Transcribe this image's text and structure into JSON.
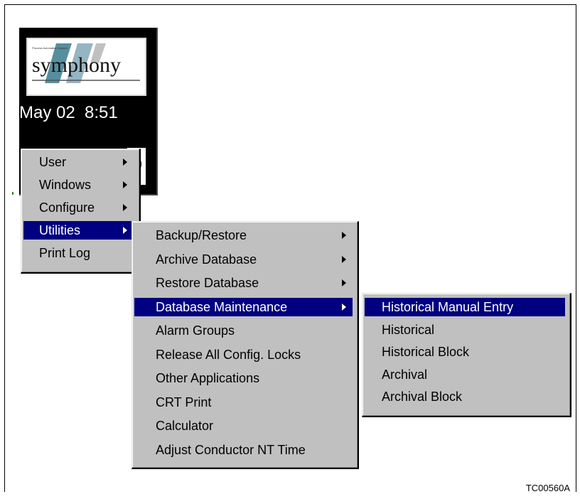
{
  "panel": {
    "logo_text": "symphony",
    "logo_tag": "Process Automation System",
    "clock": "May 02  8:51"
  },
  "main_menu": {
    "items": [
      {
        "label": "User",
        "has_submenu": true
      },
      {
        "label": "Windows",
        "has_submenu": true
      },
      {
        "label": "Configure",
        "has_submenu": true
      },
      {
        "label": "Utilities",
        "has_submenu": true,
        "selected": true
      },
      {
        "label": "Print Log",
        "has_submenu": false
      }
    ]
  },
  "utilities_menu": {
    "items": [
      {
        "label": "Backup/Restore",
        "has_submenu": true
      },
      {
        "label": "Archive Database",
        "has_submenu": true
      },
      {
        "label": "Restore Database",
        "has_submenu": true
      },
      {
        "label": "Database Maintenance",
        "has_submenu": true,
        "selected": true
      },
      {
        "label": "Alarm Groups"
      },
      {
        "label": "Release All Config. Locks"
      },
      {
        "label": "Other Applications"
      },
      {
        "label": "CRT Print"
      },
      {
        "label": "Calculator"
      },
      {
        "label": "Adjust Conductor NT Time"
      }
    ]
  },
  "db_maintenance_menu": {
    "items": [
      {
        "label": "Historical Manual Entry",
        "selected": true
      },
      {
        "label": "Historical"
      },
      {
        "label": "Historical Block"
      },
      {
        "label": "Archival"
      },
      {
        "label": "Archival Block"
      }
    ]
  },
  "caption": "TC00560A",
  "colors": {
    "highlight": "#000080",
    "menu_bg": "#c0c0c0",
    "logo_teal": "#3a7a8c"
  }
}
